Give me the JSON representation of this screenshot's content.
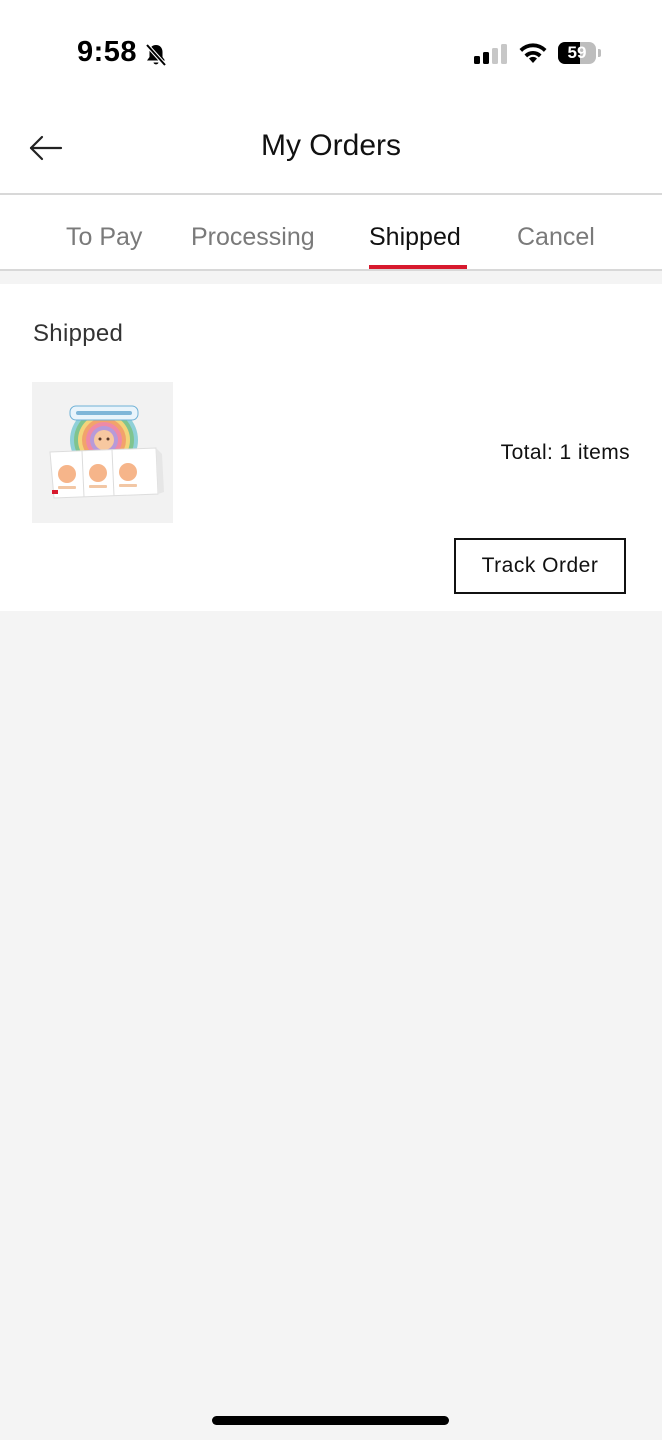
{
  "status_bar": {
    "time": "9:58",
    "battery_percent": "59",
    "battery_level": 0.59,
    "icons": [
      "bell-slash-icon",
      "signal-icon",
      "wifi-icon",
      "battery-icon"
    ]
  },
  "header": {
    "title": "My Orders",
    "back_icon": "arrow-left-icon"
  },
  "tabs": [
    {
      "label": "To Pay",
      "active": false
    },
    {
      "label": "Processing",
      "active": false
    },
    {
      "label": "Shipped",
      "active": true
    },
    {
      "label": "Cancel",
      "active": false
    }
  ],
  "accent_color": "#d7192d",
  "orders": [
    {
      "status": "Shipped",
      "thumbnail": "product-box-set-image",
      "total": "Total: 1 items",
      "action_label": "Track Order"
    }
  ]
}
